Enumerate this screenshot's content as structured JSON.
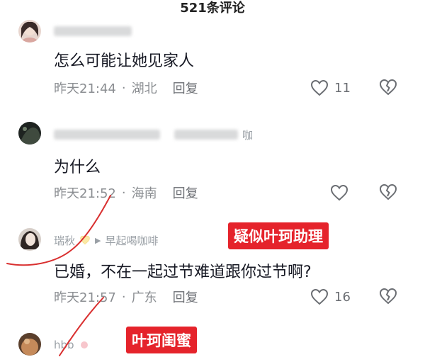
{
  "header": {
    "title": "521条评论"
  },
  "comments": [
    {
      "text": "怎么可能让她见家人",
      "time": "昨天21:44",
      "location": "湖北",
      "reply": "回复",
      "likes": "11"
    },
    {
      "username_suffix": "咖",
      "text": "为什么",
      "time": "昨天21:52",
      "location": "海南",
      "reply": "回复"
    },
    {
      "username": "瑞秋",
      "reply_to": "早起喝咖啡",
      "tag": "疑似叶珂助理",
      "text": "已婚，不在一起过节难道跟你过节啊?",
      "time": "昨天21:57",
      "location": "广东",
      "reply": "回复",
      "likes": "16"
    },
    {
      "username": "hbb",
      "tag": "叶珂闺蜜"
    }
  ],
  "colors": {
    "tag_bg": "#e5232b",
    "annotation_line": "#d93030"
  }
}
